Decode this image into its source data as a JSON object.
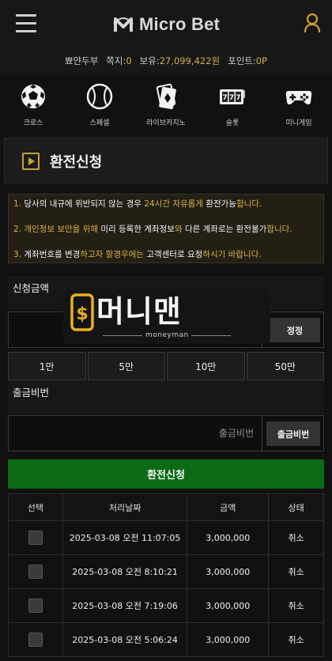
{
  "header": {
    "logo_text": "Micro Bet",
    "menu_icon": "hamburger-icon",
    "user_icon": "user-icon"
  },
  "user_info": {
    "username": "뾰얀두부",
    "messages_label": "쪽지:",
    "messages_value": "0",
    "balance_label": "보유:",
    "balance_value": "27,099,422원",
    "points_label": "포인트:",
    "points_value": "0P"
  },
  "game_nav": [
    {
      "label": "크로스",
      "icon": "soccer-ball-icon"
    },
    {
      "label": "스페셜",
      "icon": "baseball-icon"
    },
    {
      "label": "라이브카지노",
      "icon": "playing-cards-icon"
    },
    {
      "label": "슬롯",
      "icon": "slot-machine-icon"
    },
    {
      "label": "미니게임",
      "icon": "gamepad-icon"
    }
  ],
  "page_title": "환전신청",
  "notice": {
    "line1": {
      "num": "1.",
      "a": "당사의 내규에 위반되지 않는 경우",
      "b": "24시간 자유롭게",
      "c": "환전가능",
      "d": "합니다."
    },
    "line2": {
      "num": "2.",
      "a": "개인정보 보안을 위해",
      "b": "미리 등록한 계좌정보",
      "c": "와",
      "d": "다른 계좌로는",
      "e": "환전불가",
      "f": "합니다."
    },
    "line3": {
      "num": "3.",
      "a": "계좌번호를 변경",
      "b": "하고자 할경우에는",
      "c": "고객센터로 요청",
      "d": "하시기 바랍니다."
    }
  },
  "amount_section": {
    "label": "신청금액",
    "reset_button": "정정",
    "quick_amounts": [
      "1만",
      "5만",
      "10만",
      "50만"
    ]
  },
  "password_section": {
    "label": "출금비번",
    "placeholder": "출금비번",
    "button": "출금비번"
  },
  "submit_button": "환전신청",
  "history_table": {
    "headers": [
      "선택",
      "처리날짜",
      "금액",
      "상태"
    ],
    "rows": [
      {
        "date": "2025-03-08 오전 11:07:05",
        "amount": "3,000,000",
        "status": "취소"
      },
      {
        "date": "2025-03-08 오전 8:10:21",
        "amount": "3,000,000",
        "status": "취소"
      },
      {
        "date": "2025-03-08 오전 7:19:06",
        "amount": "3,000,000",
        "status": "취소"
      },
      {
        "date": "2025-03-08 오전 5:06:24",
        "amount": "3,000,000",
        "status": "취소"
      }
    ]
  },
  "watermark": {
    "main": "머니맨",
    "sub": "moneyman"
  },
  "colors": {
    "accent_gold": "#d6b24a",
    "submit_green": "#0a6b14",
    "background": "#111111"
  }
}
